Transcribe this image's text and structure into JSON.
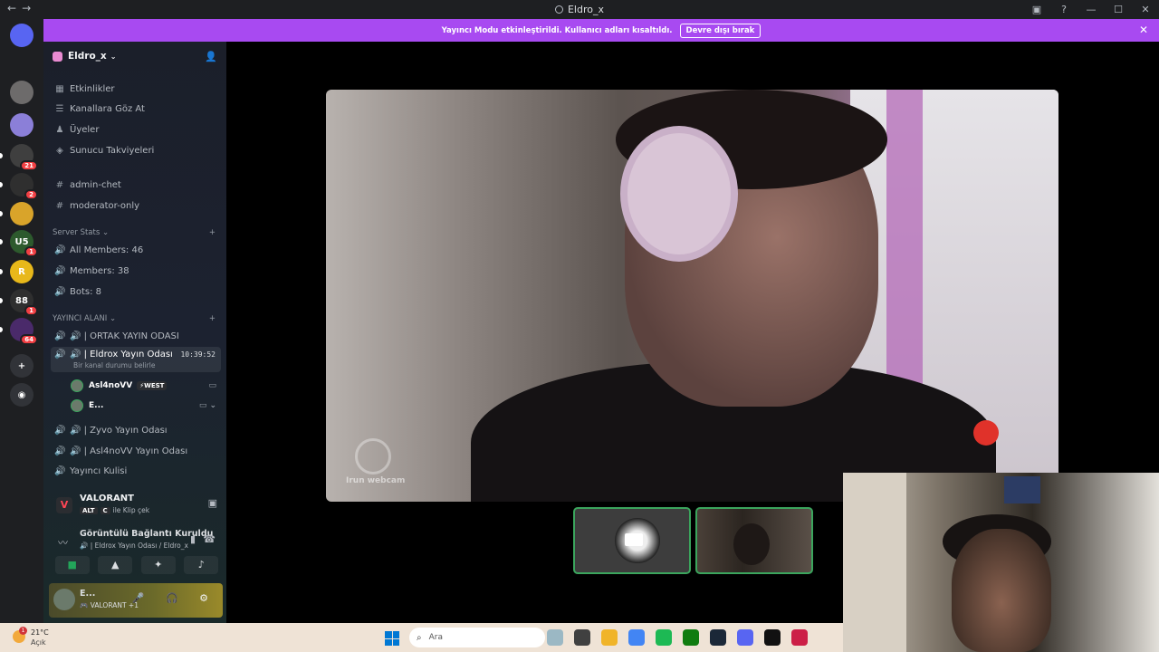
{
  "window": {
    "title": "Eldro_x",
    "nav_back": "←",
    "nav_fwd": "→",
    "inbox_icon": "▣",
    "help_icon": "?",
    "minimize": "—",
    "maximize": "☐",
    "close": "✕"
  },
  "banner": {
    "text": "Yayıncı Modu etkinleştirildi. Kullanıcı adları kısaltıldı.",
    "button": "Devre dışı bırak",
    "close": "✕"
  },
  "server_rail": [
    {
      "label": "",
      "color": "#5865f2",
      "badge": ""
    },
    {
      "label": "",
      "color": "#6d6b6b",
      "badge": ""
    },
    {
      "label": "",
      "color": "#8b7fd8",
      "badge": ""
    },
    {
      "label": "",
      "color": "#3f3f3f",
      "badge": "21"
    },
    {
      "label": "",
      "color": "#2f2f2f",
      "badge": "2"
    },
    {
      "label": "",
      "color": "#d9a42a",
      "badge": ""
    },
    {
      "label": "U5",
      "color": "#2d5a2d",
      "badge": "1"
    },
    {
      "label": "R",
      "color": "#e8b81a",
      "badge": ""
    },
    {
      "label": "88",
      "color": "#2f2f2f",
      "badge": "1"
    },
    {
      "label": "",
      "color": "#4a2a6a",
      "badge": "64"
    },
    {
      "label": "+",
      "color": "#313338",
      "badge": ""
    },
    {
      "label": "◉",
      "color": "#313338",
      "badge": ""
    }
  ],
  "sidebar": {
    "server_name": "Eldro_x",
    "invite_icon": "👤",
    "top_items": [
      {
        "icon": "▦",
        "label": "Etkinlikler"
      },
      {
        "icon": "☰",
        "label": "Kanallara Göz At"
      },
      {
        "icon": "♟",
        "label": "Üyeler"
      },
      {
        "icon": "◈",
        "label": "Sunucu Takviyeleri"
      }
    ],
    "text_channels": [
      {
        "icon": "#",
        "label": "admin-chet"
      },
      {
        "icon": "#",
        "label": "moderator-only"
      }
    ],
    "cat_stats": "Server Stats",
    "stats": [
      {
        "icon": "🔊",
        "label": "All Members: 46"
      },
      {
        "icon": "🔊",
        "label": "Members: 38"
      },
      {
        "icon": "🔊",
        "label": "Bots: 8"
      }
    ],
    "cat_yayinci": "YAYINCI ALANI",
    "voice_channels": [
      {
        "label": "🔊 | ORTAK YAYIN ODASI"
      }
    ],
    "active_channel": {
      "label": "🔊 | Eldrox Yayın Odası",
      "time": "10:39:52",
      "sub": "Bir kanal durumu belirle"
    },
    "members": [
      {
        "name": "Asl4noVV",
        "tag": "⚡WEST",
        "right": "▭"
      },
      {
        "name": "E...",
        "tag": "",
        "right": "▭ ⌄"
      }
    ],
    "more_channels": [
      {
        "label": "🔊 | Zyvo Yayın Odası"
      },
      {
        "label": "🔊 | Asl4noVV Yayın Odası"
      },
      {
        "label": "Yayıncı Kulisi"
      }
    ],
    "add_icon": "+"
  },
  "game": {
    "name": "VALORANT",
    "key1": "ALT",
    "key2": "C",
    "hint": "ile Klip çek",
    "logo": "V"
  },
  "voice": {
    "status": "Görüntülü Bağlantı Kuruldu",
    "channel": "🔊 | Eldrox Yayın Odası / Eldro_x"
  },
  "user": {
    "name": "E...",
    "status": "🎮 VALORANT +1",
    "controls": "🎤 🎧 ⚙"
  },
  "stage": {
    "main_label": "Irun webcam"
  },
  "taskbar": {
    "temp": "21°C",
    "cond": "Açık",
    "badge": "1",
    "search": "Ara",
    "apps": [
      "#9bb8c4",
      "#404040",
      "#f0b429",
      "#4285f4",
      "#1db954",
      "#107c10",
      "#1b2838",
      "#5865f2",
      "#111111",
      "#cc1f47"
    ]
  }
}
